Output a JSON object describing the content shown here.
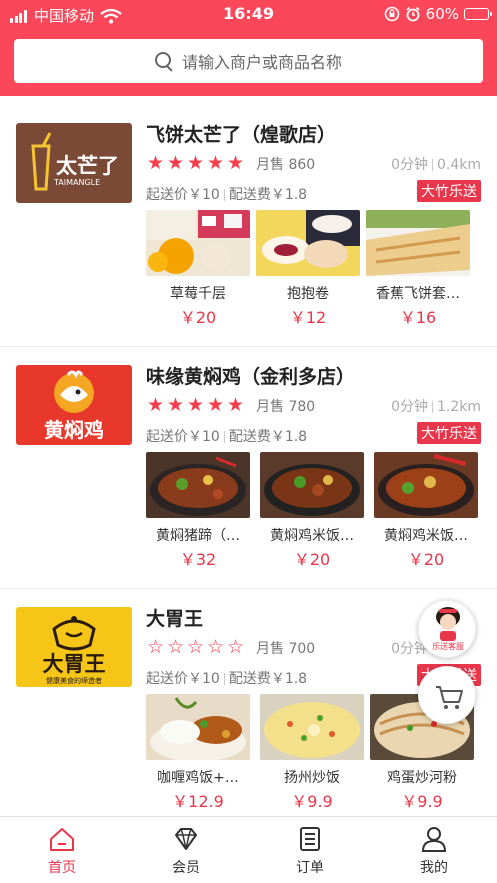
{
  "status_bar": {
    "carrier": "中国移动",
    "time": "16:49",
    "battery": "60%",
    "battery_level": 0.6
  },
  "search": {
    "placeholder": "请输入商户或商品名称"
  },
  "stores": [
    {
      "name": "飞饼太芒了（煌歌店）",
      "logo_text": "太芒了",
      "logo_subtext": "TAIMANGLE",
      "rating": 5,
      "sales_label": "月售",
      "sales": "860",
      "time": "0分钟",
      "distance": "0.4km",
      "min_order": "起送价￥10",
      "delivery_fee": "配送费￥1.8",
      "tag": "大竹乐送",
      "products": [
        {
          "name": "草莓千层",
          "price": "￥20"
        },
        {
          "name": "抱抱卷",
          "price": "￥12"
        },
        {
          "name": "香蕉飞饼套…",
          "price": "￥16"
        }
      ]
    },
    {
      "name": "味缘黄焖鸡（金利多店）",
      "logo_text": "黄焖鸡",
      "rating": 5,
      "sales_label": "月售",
      "sales": "780",
      "time": "0分钟",
      "distance": "1.2km",
      "min_order": "起送价￥10",
      "delivery_fee": "配送费￥1.8",
      "tag": "大竹乐送",
      "products": [
        {
          "name": "黄焖猪蹄（…",
          "price": "￥32"
        },
        {
          "name": "黄焖鸡米饭…",
          "price": "￥20"
        },
        {
          "name": "黄焖鸡米饭…",
          "price": "￥20"
        }
      ]
    },
    {
      "name": "大胃王",
      "logo_text": "大胃王",
      "logo_subtext": "健康美食的缔造者",
      "rating": 0,
      "sales_label": "月售",
      "sales": "700",
      "time": "0分钟",
      "distance": "",
      "min_order": "起送价￥10",
      "delivery_fee": "配送费￥1.8",
      "tag": "大竹乐送",
      "products": [
        {
          "name": "咖喱鸡饭+…",
          "price": "￥12.9"
        },
        {
          "name": "扬州炒饭",
          "price": "￥9.9"
        },
        {
          "name": "鸡蛋炒河粉",
          "price": "￥9.9"
        }
      ]
    }
  ],
  "floating": {
    "service_label": "乐送客服"
  },
  "tabbar": {
    "items": [
      {
        "label": "首页",
        "icon": "home-icon",
        "active": true
      },
      {
        "label": "会员",
        "icon": "diamond-icon",
        "active": false
      },
      {
        "label": "订单",
        "icon": "order-icon",
        "active": false
      },
      {
        "label": "我的",
        "icon": "user-icon",
        "active": false
      }
    ]
  },
  "colors": {
    "brand": "#fb4759",
    "accent": "#e8364a"
  }
}
